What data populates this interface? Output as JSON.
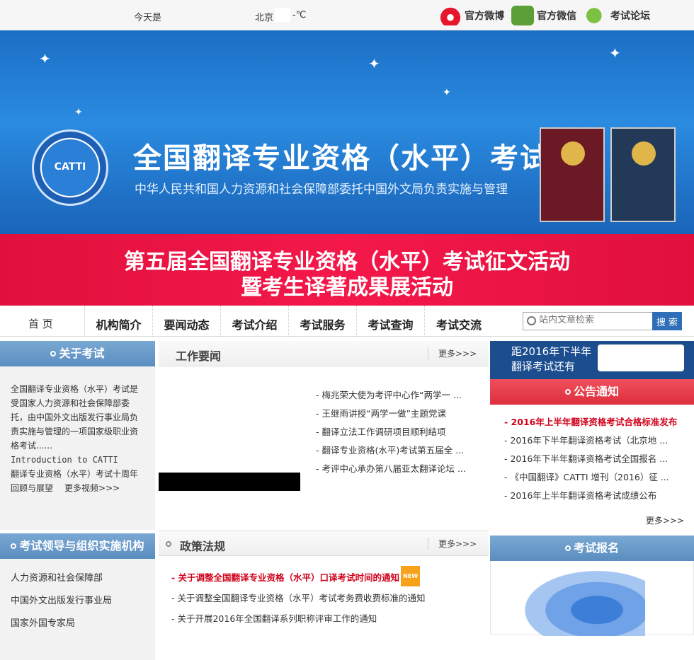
{
  "topbar": {
    "today_label": "今天是",
    "city": "北京",
    "temp": "-℃",
    "social": [
      {
        "label": "官方微博",
        "icon": "weibo-icon"
      },
      {
        "label": "官方微信",
        "icon": "wechat-icon"
      },
      {
        "label": "考试论坛",
        "icon": "forum-icon"
      }
    ]
  },
  "banner": {
    "logo_text": "CATTI",
    "title": "全国翻译专业资格（水平）考试",
    "subtitle": "中华人民共和国人力资源和社会保障部委托中国外文局负责实施与管理"
  },
  "promo": {
    "line1": "第五届全国翻译专业资格（水平）考试征文活动",
    "line2": "暨考生译著成果展活动"
  },
  "nav": {
    "home": "首 页",
    "items": [
      "机构简介",
      "要闻动态",
      "考试介绍",
      "考试服务",
      "考试查询",
      "考试交流"
    ],
    "search_placeholder": "站内文章检索",
    "search_button": "搜 索"
  },
  "about": {
    "title": "关于考试",
    "text": "全国翻译专业资格（水平）考试是受国家人力资源和社会保障部委托，由中国外文出版发行事业局负责实施与管理的一项国家级职业资格考试......",
    "intro_en": "Introduction to CATTI",
    "review": "翻译专业资格（水平）考试十周年回顾与展望",
    "more_video": "更多视频>>>"
  },
  "org": {
    "title": "考试领导与组织实施机构",
    "items": [
      "人力资源和社会保障部",
      "中国外文出版发行事业局",
      "国家外国专家局"
    ]
  },
  "work_news": {
    "title": "工作要闻",
    "more": "更多>>>",
    "items": [
      "梅兆荣大使为考评中心作“两学一 ...",
      "王继雨讲授“两学一做”主题党课",
      "翻译立法工作调研项目顺利结项",
      "翻译专业资格(水平)考试第五届全 ...",
      "考评中心承办第八届亚太翻译论坛 ..."
    ]
  },
  "policy": {
    "title": "政策法规",
    "more": "更多>>>",
    "items": [
      "关于调整全国翻译专业资格（水平）口译考试时间的通知",
      "关于调整全国翻译专业资格（水平）考试考务费收费标准的通知",
      "关于开展2016年全国翻译系列职称评审工作的通知"
    ],
    "new_tag": "NEW"
  },
  "countdown": {
    "line1": "距2016年下半年",
    "line2": "翻译考试还有"
  },
  "notice": {
    "title": "公告通知",
    "more": "更多>>>",
    "items": [
      "2016年上半年翻译资格考试合格标准发布",
      "2016年下半年翻译资格考试（北京地 ...",
      "2016年下半年翻译资格考试全国报名 ...",
      "《中国翻译》CATTI 增刊（2016）征 ...",
      "2016年上半年翻译资格考试成绩公布"
    ]
  },
  "registration": {
    "title": "考试报名"
  }
}
